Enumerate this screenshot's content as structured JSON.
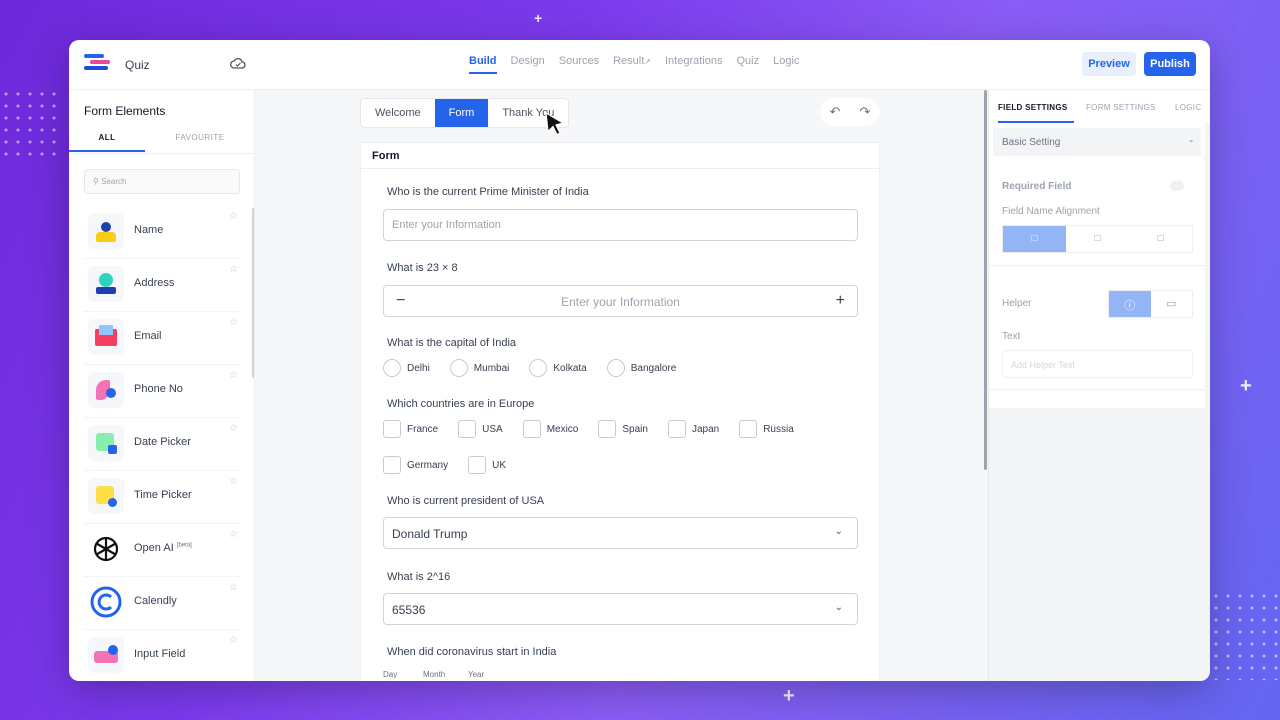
{
  "app": {
    "title": "Quiz"
  },
  "nav": [
    {
      "label": "Build",
      "active": true
    },
    {
      "label": "Design"
    },
    {
      "label": "Sources"
    },
    {
      "label": "Result"
    },
    {
      "label": "Integrations"
    },
    {
      "label": "Quiz"
    },
    {
      "label": "Logic"
    }
  ],
  "actions": {
    "preview": "Preview",
    "publish": "Publish"
  },
  "left_panel": {
    "title": "Form Elements",
    "tabs": {
      "all": "ALL",
      "favourite": "FAVOURITE"
    },
    "search_placeholder": "Search",
    "items": [
      {
        "label": "Name"
      },
      {
        "label": "Address"
      },
      {
        "label": "Email"
      },
      {
        "label": "Phone No"
      },
      {
        "label": "Date Picker"
      },
      {
        "label": "Time Picker"
      },
      {
        "label": "Open AI",
        "badge": "[beta]"
      },
      {
        "label": "Calendly"
      },
      {
        "label": "Input Field"
      }
    ]
  },
  "form_tabs": {
    "welcome": "Welcome",
    "form": "Form",
    "thank_you": "Thank You"
  },
  "form": {
    "heading": "Form",
    "q1": {
      "label": "Who is the current Prime Minister of India",
      "placeholder": "Enter your Information"
    },
    "q2": {
      "label": "What is 23 × 8",
      "placeholder": "Enter your Information"
    },
    "q3": {
      "label": "What is the capital of India",
      "options": [
        "Delhi",
        "Mumbai",
        "Kolkata",
        "Bangalore"
      ]
    },
    "q4": {
      "label": "Which countries are in Europe",
      "options": [
        "France",
        "USA",
        "Mexico",
        "Spain",
        "Japan",
        "Russia",
        "Germany",
        "UK"
      ]
    },
    "q5": {
      "label": "Who is current president of USA",
      "value": "Donald Trump"
    },
    "q6": {
      "label": "What is 2^16",
      "value": "65536"
    },
    "q7": {
      "label": "When did coronavirus start in India",
      "day": "Day",
      "month": "Month",
      "year": "Year"
    }
  },
  "right_panel": {
    "tabs": {
      "field_settings": "FIELD SETTINGS",
      "form_settings": "FORM SETTINGS",
      "logic": "LOGIC"
    },
    "basic_setting": "Basic Setting",
    "required_field": "Required Field",
    "field_name_alignment": "Field Name Alignment",
    "helper": "Helper",
    "text": "Text",
    "helper_placeholder": "Add Helper Text"
  },
  "colors": {
    "accent": "#2563eb",
    "background": "#7c3aed"
  }
}
